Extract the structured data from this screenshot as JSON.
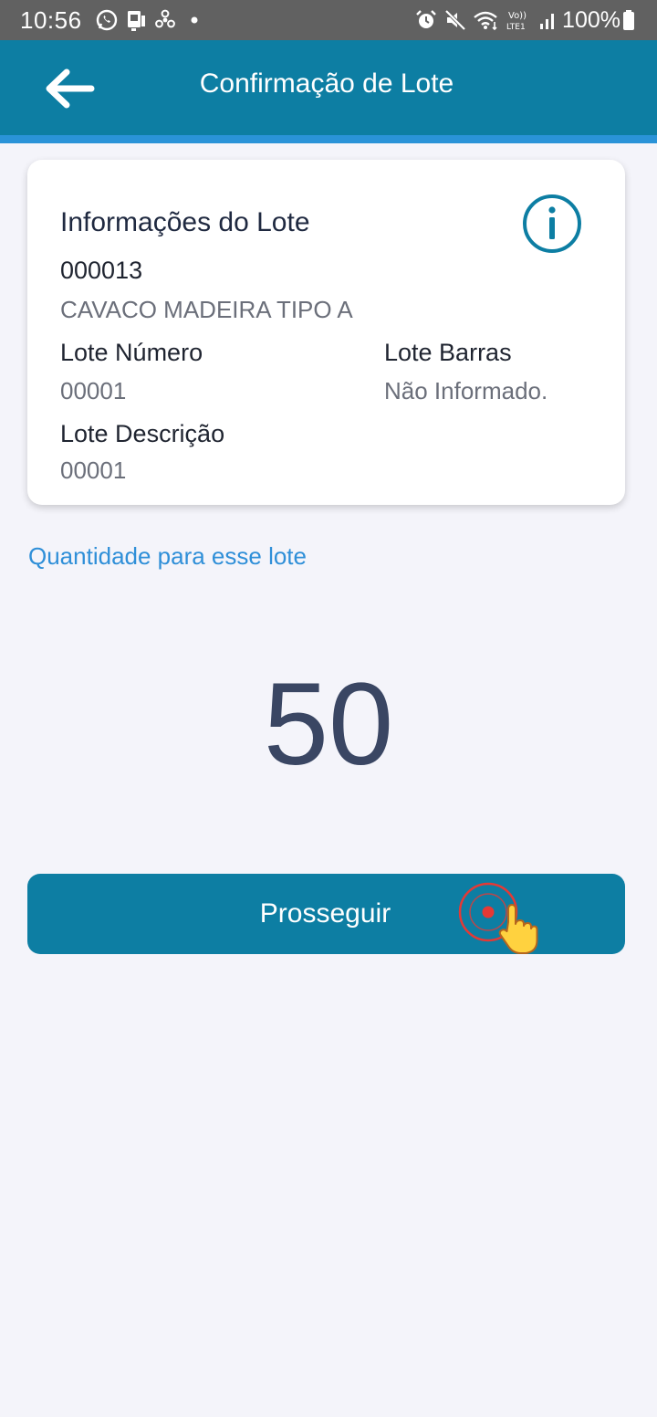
{
  "status_bar": {
    "time": "10:56",
    "battery": "100%",
    "left_icons": [
      "whatsapp-icon",
      "sim-icon",
      "fan-icon",
      "dot-icon"
    ],
    "right_icons": [
      "alarm-icon",
      "mute-icon",
      "wifi-icon",
      "volte-icon",
      "signal-icon",
      "battery-icon"
    ],
    "background_color": "#616161"
  },
  "app_bar": {
    "title": "Confirmação de Lote",
    "back_icon": "arrow-left-icon",
    "color": "#0d7ea3",
    "accent_line_color": "#2a93d8"
  },
  "lot_card": {
    "title": "Informações do Lote",
    "info_icon": "info-icon",
    "product_code": "000013",
    "product_description": "CAVACO MADEIRA TIPO A",
    "fields": {
      "lot_number_label": "Lote Número",
      "lot_number_value": "00001",
      "lot_barcode_label": "Lote Barras",
      "lot_barcode_value": "Não Informado.",
      "lot_description_label": "Lote Descrição",
      "lot_description_value": "00001"
    }
  },
  "quantity": {
    "label": "Quantidade para esse lote",
    "value": "50"
  },
  "actions": {
    "proceed_label": "Prosseguir",
    "button_color": "#0d7ea3"
  },
  "overlay": {
    "tap_icon": "tap-hand-icon"
  }
}
